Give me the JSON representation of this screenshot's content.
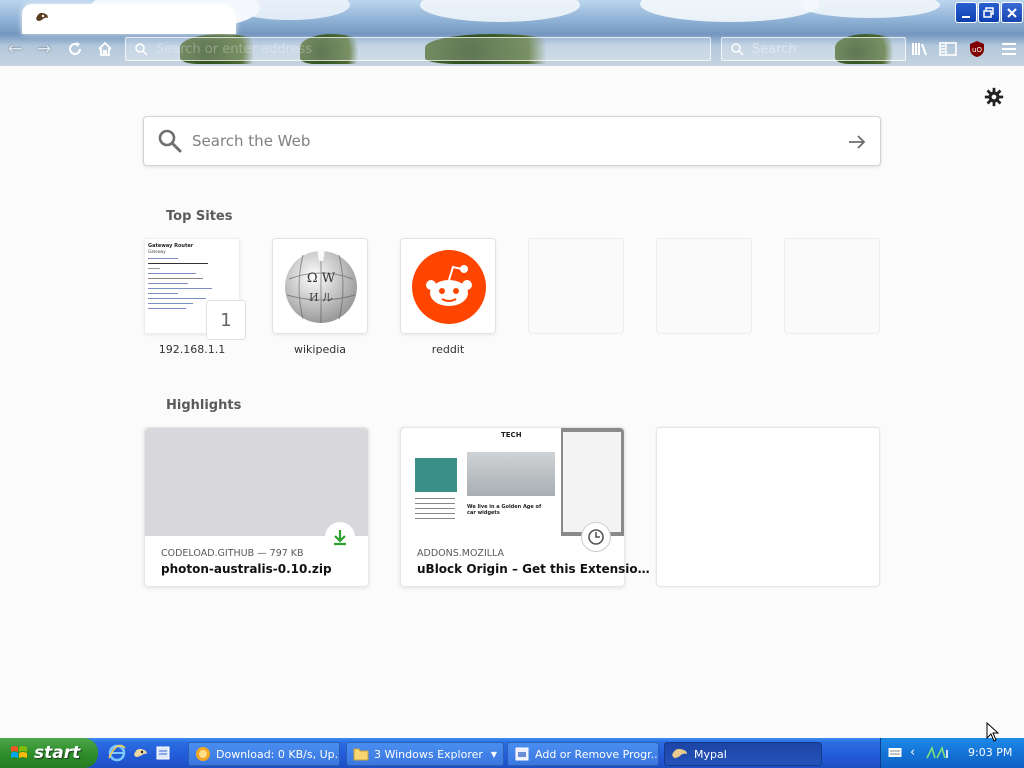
{
  "browser": {
    "tab_title": "",
    "url_placeholder": "Search or enter address",
    "search_placeholder": "Search",
    "window_buttons": [
      "minimize",
      "restore",
      "close"
    ]
  },
  "newtab": {
    "search_placeholder": "Search the Web",
    "top_sites_title": "Top Sites",
    "top_sites": [
      {
        "label": "192.168.1.1",
        "badge": "1"
      },
      {
        "label": "wikipedia"
      },
      {
        "label": "reddit"
      },
      {
        "label": ""
      },
      {
        "label": ""
      },
      {
        "label": ""
      }
    ],
    "router_page": {
      "title": "Gateway Router",
      "subtitle": "Gateway"
    },
    "highlights_title": "Highlights",
    "highlights": [
      {
        "source": "CODELOAD.GITHUB — 797 KB",
        "title": "photon-australis-0.10.zip",
        "icon": "download-icon"
      },
      {
        "source": "ADDONS.MOZILLA",
        "title": "uBlock Origin – Get this Extensio…",
        "icon": "clock-icon",
        "image_header": "TECH",
        "image_caption": "We live in a Golden Age of car widgets"
      }
    ]
  },
  "taskbar": {
    "start_label": "start",
    "buttons": [
      {
        "label": "Download: 0 KB/s, Up..."
      },
      {
        "label": "3 Windows Explorer"
      },
      {
        "label": "Add or Remove Progr..."
      },
      {
        "label": "Mypal"
      }
    ],
    "clock": "9:03 PM"
  },
  "colors": {
    "reddit": "#ff4500",
    "download_green": "#2ea12e",
    "taskbar_blue": "#245edb",
    "start_green": "#3a9a37"
  }
}
